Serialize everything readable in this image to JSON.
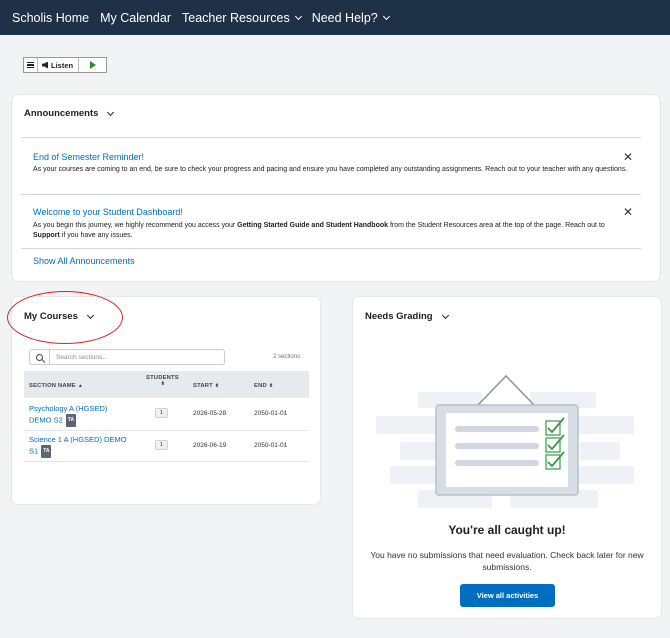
{
  "nav": {
    "items": [
      {
        "label": "Scholis Home",
        "has_dropdown": false
      },
      {
        "label": "My Calendar",
        "has_dropdown": false
      },
      {
        "label": "Teacher Resources",
        "has_dropdown": true
      },
      {
        "label": "Need Help?",
        "has_dropdown": true
      }
    ],
    "background": "#1f3146"
  },
  "listen_bar": {
    "listen_label": "Listen",
    "icons": [
      "menu-icon",
      "speaker-icon",
      "play-icon"
    ]
  },
  "announcements": {
    "title": "Announcements",
    "items": [
      {
        "title": "End of Semester Reminder!",
        "body": "As your courses are coming to an end, be sure to check your progress and pacing and ensure you have completed any outstanding assignments. Reach out to your teacher with any questions."
      },
      {
        "title": "Welcome to your Student Dashboard!",
        "body_parts": [
          {
            "text": "As you begin this journey, we highly recommend you access your "
          },
          {
            "text": "Getting Started Guide and Student Handbook",
            "bold": true
          },
          {
            "text": " from the Student Resources area at the top of the page. Reach out to "
          },
          {
            "text": "Support",
            "bold": true
          },
          {
            "text": " if you have any issues."
          }
        ]
      }
    ],
    "close_glyph": "✕",
    "show_all": "Show All Announcements"
  },
  "my_courses": {
    "title": "My Courses",
    "search_placeholder": "Search sections...",
    "section_count": "2 sections",
    "columns": {
      "name": "SECTION NAME",
      "name_sort": "▲",
      "students_line1": "STUDENTS",
      "students_sort": "⬍",
      "start": "START",
      "start_sort": "⬍",
      "end": "END",
      "end_sort": "⬍"
    },
    "rows": [
      {
        "name_line1": "Psychology A (HGSED)",
        "name_line2": "DEMO S2",
        "badge": "TA",
        "students": "1",
        "start": "2026-05-28",
        "end": "2050-01-01"
      },
      {
        "name_line1": "Science 1 A (HGSED) DEMO",
        "name_line2": "S1",
        "badge": "TA",
        "students": "1",
        "start": "2026-06-19",
        "end": "2050-01-01"
      }
    ]
  },
  "needs_grading": {
    "title": "Needs Grading",
    "headline": "You're all caught up!",
    "message": "You have no submissions that need evaluation. Check back later for new submissions.",
    "button": "View all activities"
  },
  "colors": {
    "link": "#006fbf",
    "annotation_circle": "#d9231f",
    "check_green": "#3a9a46"
  }
}
